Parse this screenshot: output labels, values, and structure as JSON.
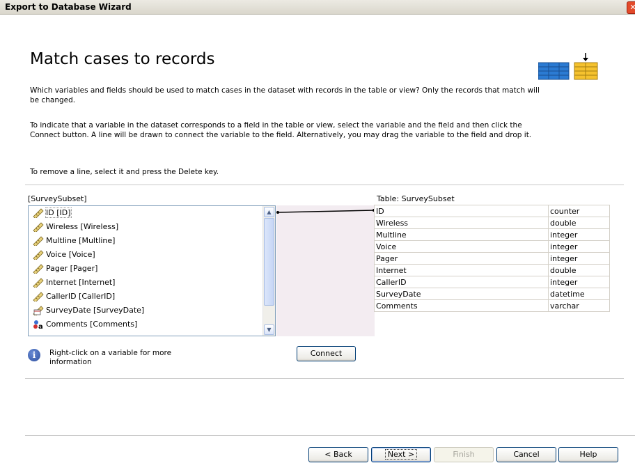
{
  "window": {
    "title": "Export to Database Wizard",
    "close_glyph": "✕"
  },
  "page": {
    "heading": "Match cases to records",
    "para1": "Which variables and fields should be used to match cases in the dataset with records in the table or view? Only the records that match will be changed.",
    "para2": "To indicate that a variable in the dataset corresponds to a field in the table or view, select the variable and the field and then click the Connect button. A line will be drawn to connect the variable to the field. Alternatively, you may drag the variable to the field and drop it.",
    "para3": "To remove a line, select it and press the Delete key."
  },
  "variables": {
    "label": "[SurveySubset]",
    "items": [
      {
        "label": "ID [ID]",
        "icon": "ruler-icon"
      },
      {
        "label": "Wireless [Wireless]",
        "icon": "ruler-icon"
      },
      {
        "label": "Multline [Multline]",
        "icon": "ruler-icon"
      },
      {
        "label": "Voice [Voice]",
        "icon": "ruler-icon"
      },
      {
        "label": "Pager [Pager]",
        "icon": "ruler-icon"
      },
      {
        "label": "Internet [Internet]",
        "icon": "ruler-icon"
      },
      {
        "label": "CallerID [CallerID]",
        "icon": "ruler-icon"
      },
      {
        "label": "SurveyDate [SurveyDate]",
        "icon": "date-icon"
      },
      {
        "label": "Comments [Comments]",
        "icon": "string-icon"
      }
    ]
  },
  "fields": {
    "label": "Table: SurveySubset",
    "rows": [
      {
        "name": "ID",
        "type": "counter"
      },
      {
        "name": "Wireless",
        "type": "double"
      },
      {
        "name": "Multline",
        "type": "integer"
      },
      {
        "name": "Voice",
        "type": "integer"
      },
      {
        "name": "Pager",
        "type": "integer"
      },
      {
        "name": "Internet",
        "type": "double"
      },
      {
        "name": "CallerID",
        "type": "integer"
      },
      {
        "name": "SurveyDate",
        "type": "datetime"
      },
      {
        "name": "Comments",
        "type": "varchar"
      }
    ]
  },
  "info": {
    "icon": "info-icon",
    "text": "Right-click on a variable for more information"
  },
  "buttons": {
    "connect": "Connect",
    "back": "< Back",
    "next": "Next >",
    "finish": "Finish",
    "cancel": "Cancel",
    "help": "Help"
  },
  "colors": {
    "connect_panel": "#F3ECF1",
    "titlebar": "#ECEAE3",
    "close": "#E24A2A"
  }
}
